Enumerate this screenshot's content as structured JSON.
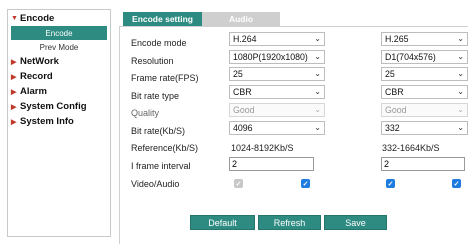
{
  "sidebar": {
    "groups": [
      {
        "label": "Encode",
        "arrow": "▼"
      },
      {
        "label": "NetWork",
        "arrow": "▶"
      },
      {
        "label": "Record",
        "arrow": "▶"
      },
      {
        "label": "Alarm",
        "arrow": "▶"
      },
      {
        "label": "System Config",
        "arrow": "▶"
      },
      {
        "label": "System Info",
        "arrow": "▶"
      }
    ],
    "encode_items": [
      {
        "label": "Encode"
      },
      {
        "label": "Prev Mode"
      }
    ]
  },
  "tabs": [
    {
      "label": "Encode setting"
    },
    {
      "label": "Audio"
    }
  ],
  "labels": {
    "encode_mode": "Encode mode",
    "resolution": "Resolution",
    "frame_rate": "Frame rate(FPS)",
    "bit_rate_type": "Bit rate type",
    "quality": "Quality",
    "bit_rate": "Bit rate(Kb/S)",
    "reference": "Reference(Kb/S)",
    "i_frame_interval": "I frame interval",
    "video_audio": "Video/Audio"
  },
  "main_stream": {
    "encode_mode": "H.264",
    "resolution": "1080P(1920x1080)",
    "frame_rate": "25",
    "bit_rate_type": "CBR",
    "quality": "Good",
    "bit_rate": "4096",
    "reference": "1024-8192Kb/S",
    "i_frame_interval": "2",
    "video_checked": true,
    "audio_checked": true
  },
  "sub_stream": {
    "encode_mode": "H.265",
    "resolution": "D1(704x576)",
    "frame_rate": "25",
    "bit_rate_type": "CBR",
    "quality": "Good",
    "bit_rate": "332",
    "reference": "332-1664Kb/S",
    "i_frame_interval": "2",
    "video_checked": true,
    "audio_checked": true
  },
  "buttons": {
    "default": "Default",
    "refresh": "Refresh",
    "save": "Save"
  },
  "colors": {
    "accent": "#2e8b82",
    "checkbox": "#1e7be0",
    "arrow": "#c0392b"
  }
}
